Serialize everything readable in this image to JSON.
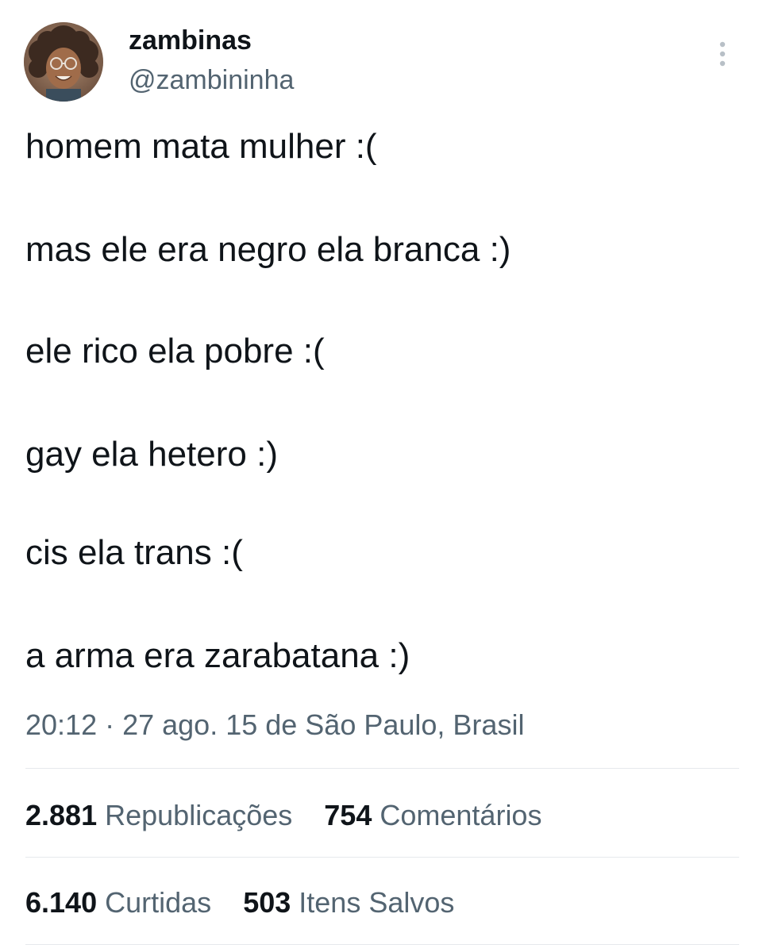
{
  "user": {
    "display_name": "zambinas",
    "handle": "@zambininha"
  },
  "tweet": {
    "lines": [
      "homem mata mulher :(",
      "mas ele era negro ela branca :)",
      "ele rico ela pobre :(",
      "gay ela hetero :)",
      "cis ela trans :(",
      "a arma era zarabatana :)"
    ],
    "meta": "20:12 · 27 ago. 15 de São Paulo, Brasil"
  },
  "stats": {
    "reposts": {
      "count": "2.881",
      "label": "Republicações"
    },
    "comments": {
      "count": "754",
      "label": "Comentários"
    },
    "likes": {
      "count": "6.140",
      "label": "Curtidas"
    },
    "bookmarks": {
      "count": "503",
      "label": "Itens Salvos"
    }
  },
  "icons": {
    "more": "vertical-ellipsis-icon"
  },
  "colors": {
    "text_primary": "#0f1419",
    "text_secondary": "#536471",
    "divider": "#e6e9ec"
  }
}
